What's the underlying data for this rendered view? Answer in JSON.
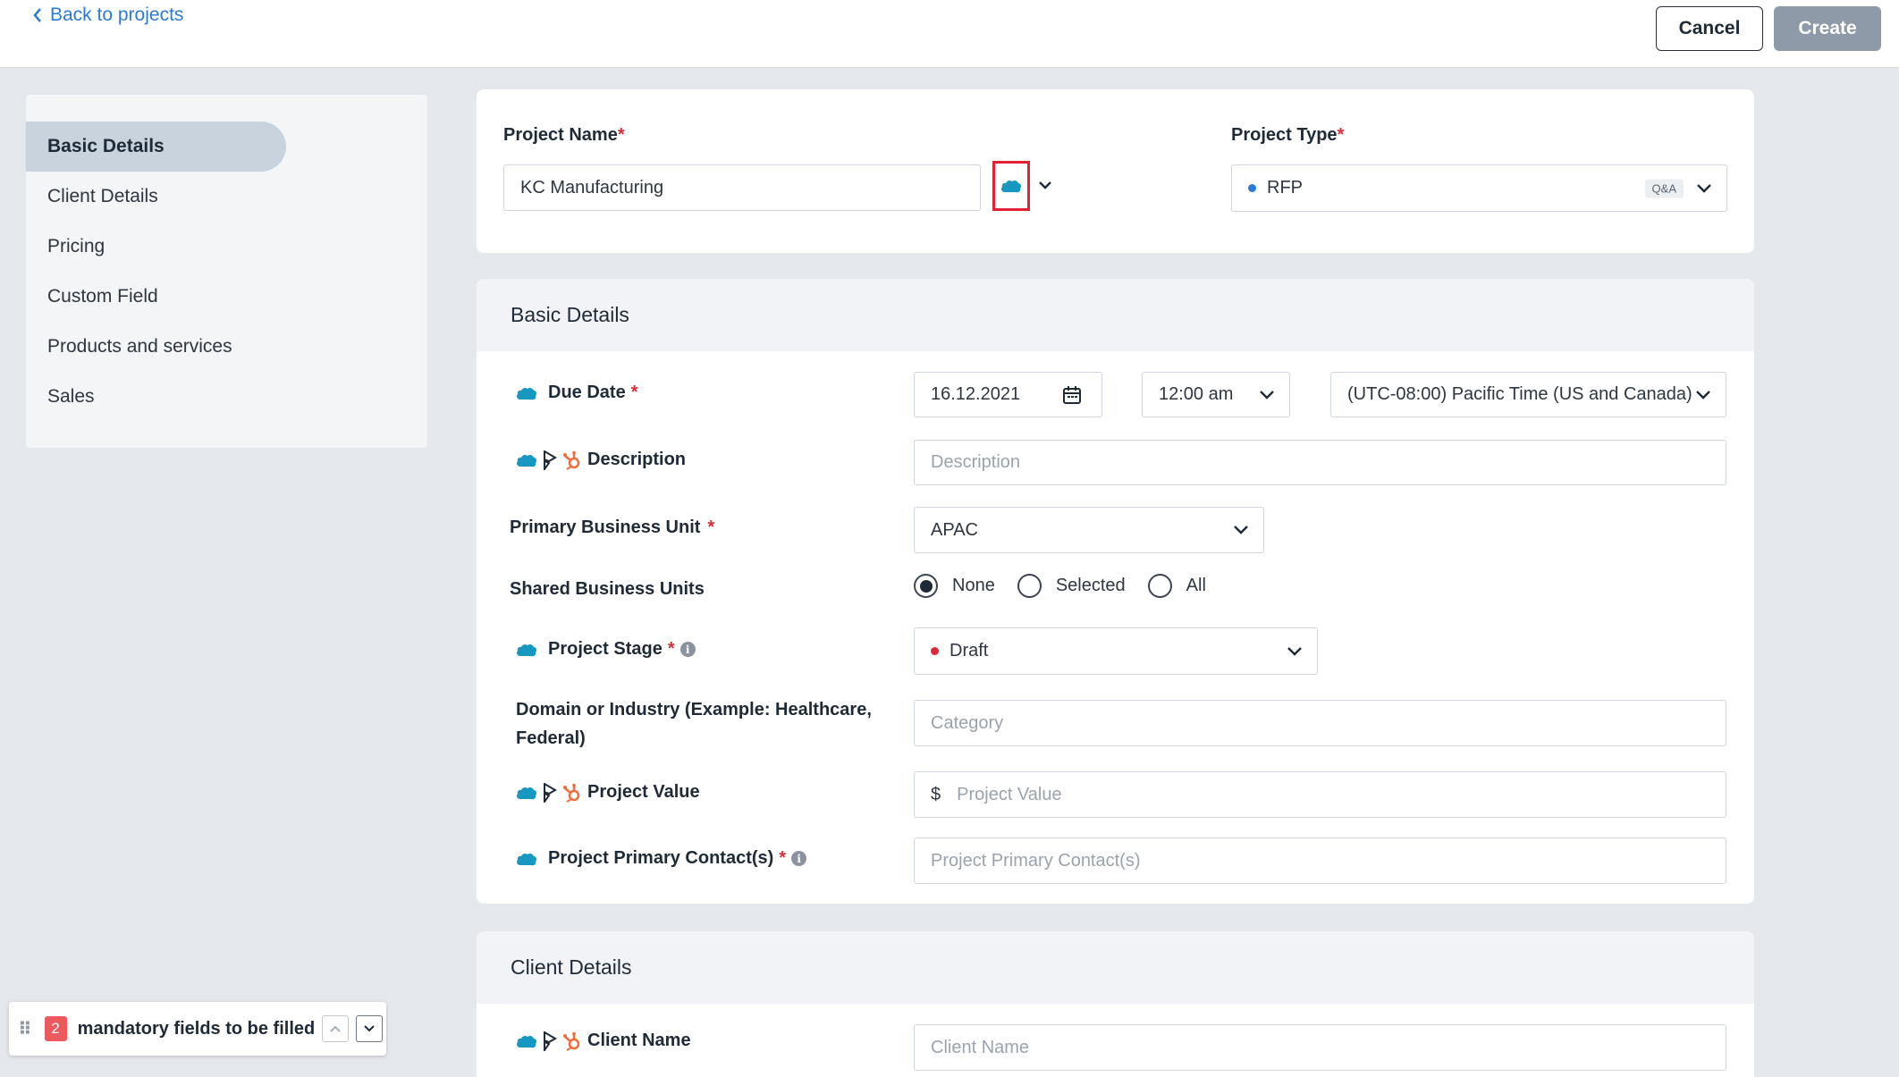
{
  "header": {
    "back_label": "Back to projects",
    "cancel_label": "Cancel",
    "create_label": "Create"
  },
  "sidebar": {
    "items": [
      {
        "label": "Basic Details",
        "active": true
      },
      {
        "label": "Client Details"
      },
      {
        "label": "Pricing"
      },
      {
        "label": "Custom Field"
      },
      {
        "label": "Products and services"
      },
      {
        "label": "Sales"
      }
    ]
  },
  "top_card": {
    "project_name_label": "Project Name",
    "project_name_value": "KC Manufacturing",
    "project_type_label": "Project Type",
    "project_type_value": "RFP",
    "project_type_badge": "Q&A",
    "required_mark": "*"
  },
  "basic": {
    "section_title": "Basic Details",
    "due_date_label": "Due Date",
    "due_date_value": "16.12.2021",
    "due_time_value": "12:00 am",
    "timezone_value": "(UTC-08:00) Pacific Time (US and Canada)",
    "description_label": "Description",
    "description_placeholder": "Description",
    "pbu_label": "Primary Business Unit",
    "pbu_value": "APAC",
    "sbu_label": "Shared Business Units",
    "sbu_options": [
      "None",
      "Selected",
      "All"
    ],
    "sbu_selected": "None",
    "stage_label": "Project Stage",
    "stage_value": "Draft",
    "stage_color": "#e0263b",
    "domain_label_line1": "Domain or Industry (Example: Healthcare,",
    "domain_label_line2": "Federal)",
    "domain_placeholder": "Category",
    "value_label": "Project Value",
    "value_currency": "$",
    "value_placeholder": "Project Value",
    "contact_label": "Project Primary Contact(s)",
    "contact_placeholder": "Project Primary Contact(s)"
  },
  "client": {
    "section_title": "Client Details",
    "client_name_label": "Client Name",
    "client_name_placeholder": "Client Name"
  },
  "footer_widget": {
    "count": "2",
    "text": "mandatory fields to be filled"
  },
  "colors": {
    "link": "#2b7bd6",
    "salesforce": "#1798c1",
    "hubspot": "#f26b3a",
    "required": "#d22f3c"
  },
  "icons": [
    "chevron-left-icon",
    "salesforce-icon",
    "dynamics-icon",
    "hubspot-icon",
    "calendar-icon",
    "chevron-down-icon",
    "info-icon",
    "drag-handle-icon",
    "chevron-up-icon"
  ]
}
